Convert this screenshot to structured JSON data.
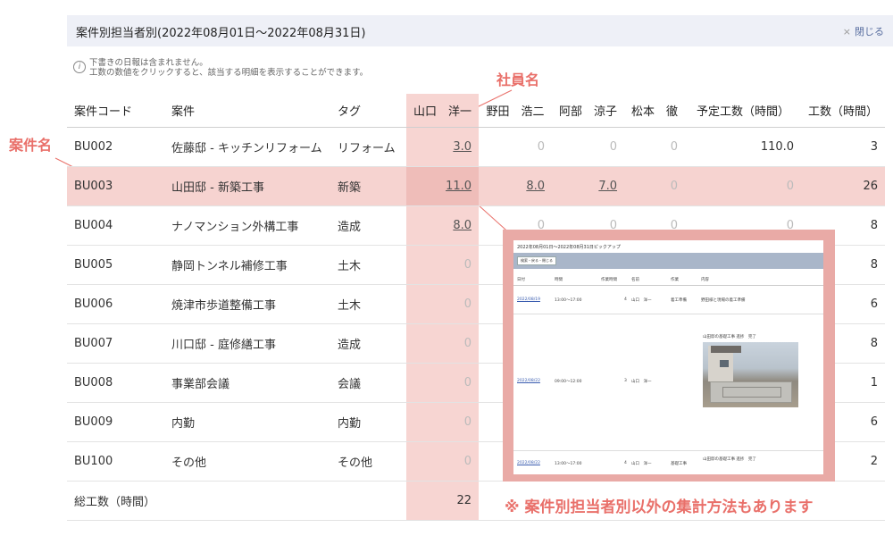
{
  "header": {
    "title": "案件別担当者別(2022年08月01日～2022年08月31日)",
    "close_x": "×",
    "close_label": "閉じる"
  },
  "info": {
    "icon": "i",
    "line1": "下書きの日報は含まれません。",
    "line2": "工数の数値をクリックすると、該当する明細を表示することができます。"
  },
  "callouts": {
    "staff": "社員名",
    "case": "案件名"
  },
  "table": {
    "headers": {
      "code": "案件コード",
      "case": "案件",
      "tag": "タグ",
      "s1": "山口　洋一",
      "s2": "野田　浩二",
      "s3": "阿部　涼子",
      "s4": "松本　徹",
      "planned": "予定工数（時間）",
      "hours": "工数（時間）"
    },
    "rows": [
      {
        "code": "BU002",
        "case": "佐藤邸 - キッチンリフォーム",
        "tag": "リフォーム",
        "s1": "3.0",
        "s2": "0",
        "s3": "0",
        "s4": "0",
        "planned": "110.0",
        "hours": "3"
      },
      {
        "code": "BU003",
        "case": "山田邸 - 新築工事",
        "tag": "新築",
        "s1": "11.0",
        "s2": "8.0",
        "s3": "7.0",
        "s4": "0",
        "planned": "0",
        "hours": "26"
      },
      {
        "code": "BU004",
        "case": "ナノマンション外構工事",
        "tag": "造成",
        "s1": "8.0",
        "s2": "0",
        "s3": "0",
        "s4": "0",
        "planned": "0",
        "hours": "8"
      },
      {
        "code": "BU005",
        "case": "静岡トンネル補修工事",
        "tag": "土木",
        "s1": "0",
        "hours": "8"
      },
      {
        "code": "BU006",
        "case": "焼津市歩道整備工事",
        "tag": "土木",
        "s1": "0",
        "hours": "6"
      },
      {
        "code": "BU007",
        "case": "川口邸 - 庭修繕工事",
        "tag": "造成",
        "s1": "0",
        "hours": "8"
      },
      {
        "code": "BU008",
        "case": "事業部会議",
        "tag": "会議",
        "s1": "0",
        "hours": "1"
      },
      {
        "code": "BU009",
        "case": "内勤",
        "tag": "内勤",
        "s1": "0",
        "hours": "6"
      },
      {
        "code": "BU100",
        "case": "その他",
        "tag": "その他",
        "s1": "0",
        "hours": "2"
      }
    ],
    "total": {
      "label": "総工数（時間）",
      "s1": "22"
    }
  },
  "popup": {
    "title": "2022年08月01日～2022年08月31日ピックアップ",
    "button": "検索・戻る・閉じる",
    "headers": {
      "date": "日付",
      "time": "時間",
      "work_hours": "作業時間",
      "name": "名前",
      "work": "作業",
      "content": "内容"
    },
    "rows": [
      {
        "date": "2022/08/19",
        "time": "13:00～17:00",
        "hours": "4",
        "name": "山口　洋一",
        "work": "着工準備",
        "content": "野田様と現場の着工準備"
      },
      {
        "date": "2022/08/22",
        "time": "09:00～12:00",
        "hours": "3",
        "name": "山口　洋一",
        "work": "",
        "content": "山田邸の基礎工事 進捗　完了"
      },
      {
        "date": "2022/08/22",
        "time": "13:00～17:00",
        "hours": "4",
        "name": "山口　洋一",
        "work": "基礎工事",
        "content": "山田邸の基礎工事 進捗　完了"
      }
    ]
  },
  "notice": "※ 案件別担当者別以外の集計方法もあります"
}
